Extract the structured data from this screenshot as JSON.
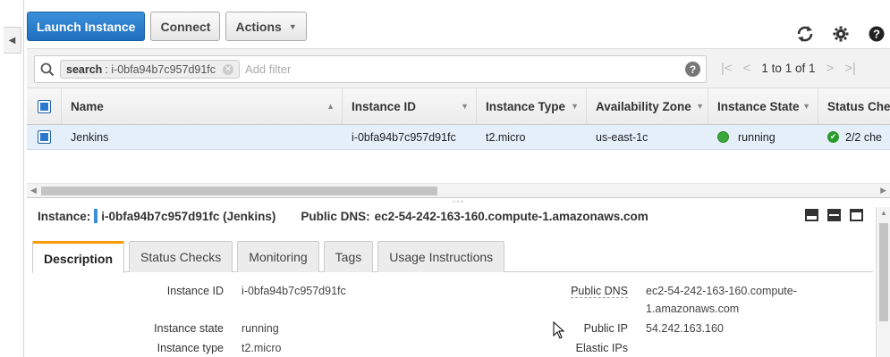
{
  "toolbar": {
    "launch_label": "Launch Instance",
    "connect_label": "Connect",
    "actions_label": "Actions"
  },
  "filter": {
    "token_key": "search",
    "token_value": "i-0bfa94b7c957d91fc",
    "placeholder": "Add filter",
    "pager_text": "1 to 1 of 1"
  },
  "table": {
    "columns": [
      "Name",
      "Instance ID",
      "Instance Type",
      "Availability Zone",
      "Instance State",
      "Status Che"
    ],
    "rows": [
      {
        "name": "Jenkins",
        "instance_id": "i-0bfa94b7c957d91fc",
        "instance_type": "t2.micro",
        "availability_zone": "us-east-1c",
        "instance_state": "running",
        "status_checks": "2/2 che"
      }
    ]
  },
  "detail": {
    "instance_label": "Instance:",
    "instance_value": "i-0bfa94b7c957d91fc (Jenkins)",
    "public_dns_label": "Public DNS:",
    "public_dns_value": "ec2-54-242-163-160.compute-1.amazonaws.com",
    "tabs": [
      "Description",
      "Status Checks",
      "Monitoring",
      "Tags",
      "Usage Instructions"
    ],
    "fields_left": [
      {
        "label": "Instance ID",
        "value": "i-0bfa94b7c957d91fc"
      },
      {
        "label": "Instance state",
        "value": "running"
      },
      {
        "label": "Instance type",
        "value": "t2.micro"
      }
    ],
    "fields_right": [
      {
        "label": "Public DNS",
        "value_line1": "ec2-54-242-163-160.compute-",
        "value_line2": "1.amazonaws.com"
      },
      {
        "label": "Public IP",
        "value": "54.242.163.160"
      },
      {
        "label": "Elastic IPs",
        "value": ""
      }
    ]
  },
  "colors": {
    "primary_button": "#2b7bd0",
    "selected_row": "#e4effa",
    "running_green": "#3aa83a",
    "active_tab_accent": "#ff9900"
  }
}
